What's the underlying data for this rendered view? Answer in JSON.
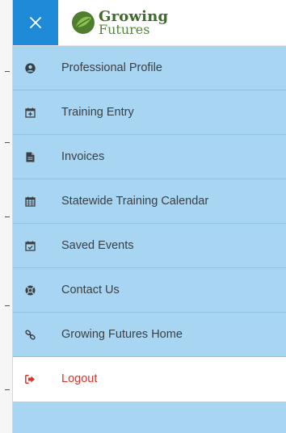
{
  "header": {
    "close_icon": "close-icon",
    "logo_line1": "Growing",
    "logo_line2": "Futures",
    "logo_color": "#3e6b2a",
    "close_bg_color": "#1f8ad8"
  },
  "menu": {
    "bg_color": "#a8d5f2",
    "items": [
      {
        "label": "Professional Profile",
        "icon": "user-circle-icon"
      },
      {
        "label": "Training Entry",
        "icon": "calendar-plus-icon"
      },
      {
        "label": "Invoices",
        "icon": "document-icon"
      },
      {
        "label": "Statewide Training Calendar",
        "icon": "calendar-icon"
      },
      {
        "label": "Saved Events",
        "icon": "calendar-check-icon"
      },
      {
        "label": "Contact Us",
        "icon": "life-ring-icon"
      },
      {
        "label": "Growing Futures Home",
        "icon": "link-icon"
      },
      {
        "label": "Logout",
        "icon": "sign-out-icon",
        "color": "#d9342b"
      }
    ]
  }
}
